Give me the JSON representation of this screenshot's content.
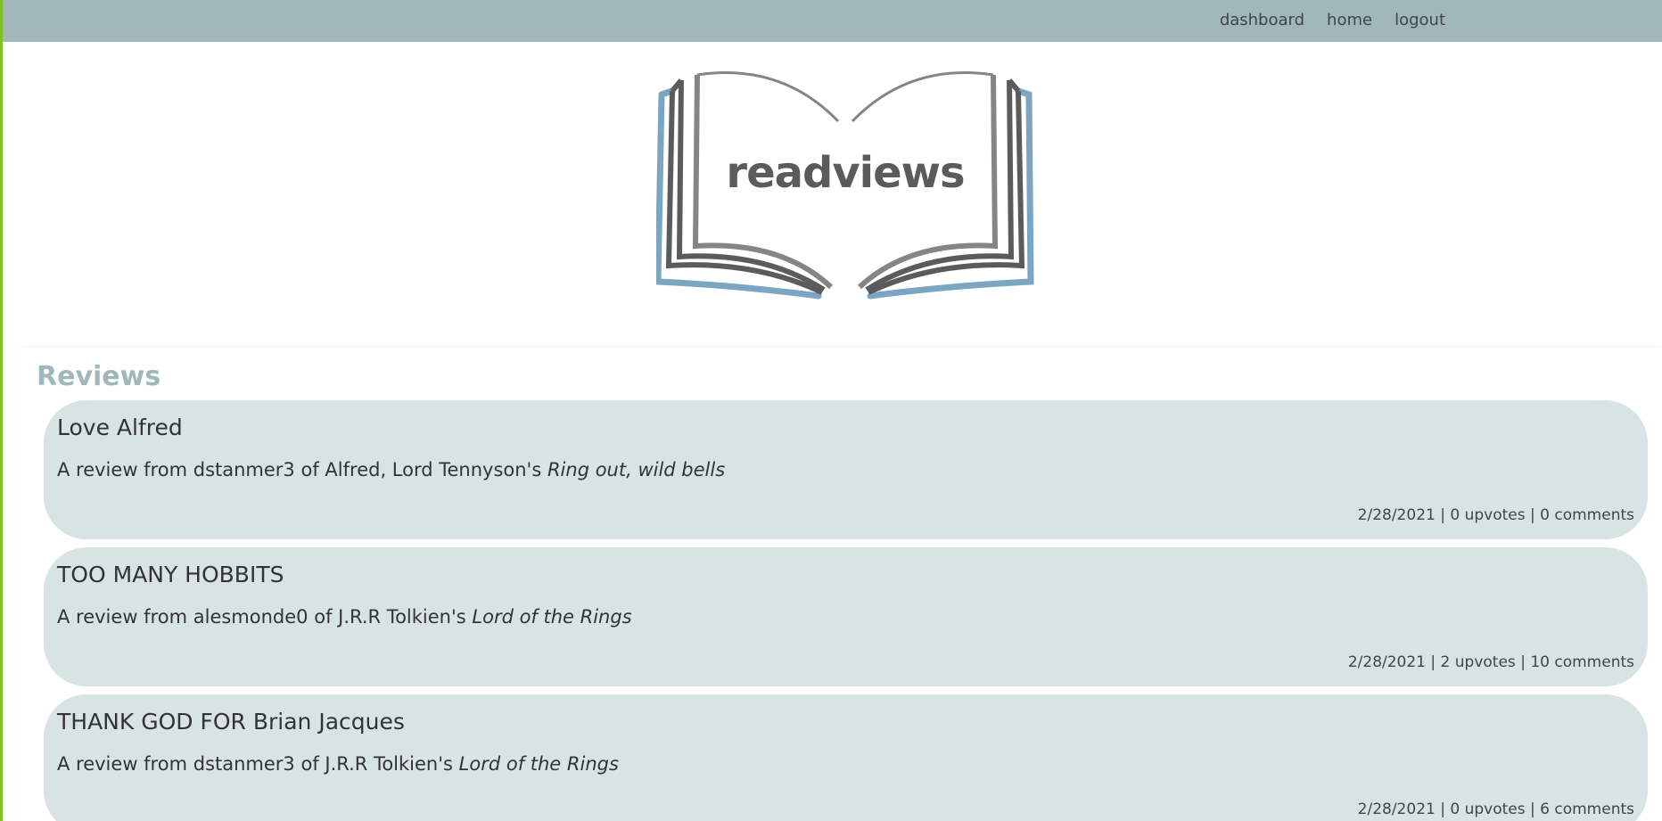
{
  "nav": {
    "dashboard": "dashboard",
    "home": "home",
    "logout": "logout"
  },
  "logo": {
    "text": "readviews"
  },
  "section": {
    "title": "Reviews"
  },
  "reviews": [
    {
      "title": "Love Alfred",
      "prefix": "A review from",
      "user": "dstanmer3",
      "of": "of",
      "author": "Alfred, Lord Tennyson's",
      "book": "Ring out, wild bells",
      "date": "2/28/2021",
      "upvotes": "0 upvotes",
      "comments": "0 comments",
      "sep": "|"
    },
    {
      "title": "TOO MANY HOBBITS",
      "prefix": "A review from",
      "user": "alesmonde0",
      "of": "of",
      "author": "J.R.R Tolkien's",
      "book": "Lord of the Rings",
      "date": "2/28/2021",
      "upvotes": "2 upvotes",
      "comments": "10 comments",
      "sep": "|"
    },
    {
      "title": "THANK GOD FOR Brian Jacques",
      "prefix": "A review from",
      "user": "dstanmer3",
      "of": "of",
      "author": "J.R.R Tolkien's",
      "book": "Lord of the Rings",
      "date": "2/28/2021",
      "upvotes": "0 upvotes",
      "comments": "6 comments",
      "sep": "|"
    }
  ],
  "colors": {
    "topbar": "#a1b8ba",
    "accent_left": "#84c11e",
    "card_bg": "#d8e3e4",
    "section_title": "#a1b8ba",
    "logo_blue": "#7aa6c1",
    "logo_dark": "#5b5b5b",
    "logo_grey": "#858585"
  }
}
